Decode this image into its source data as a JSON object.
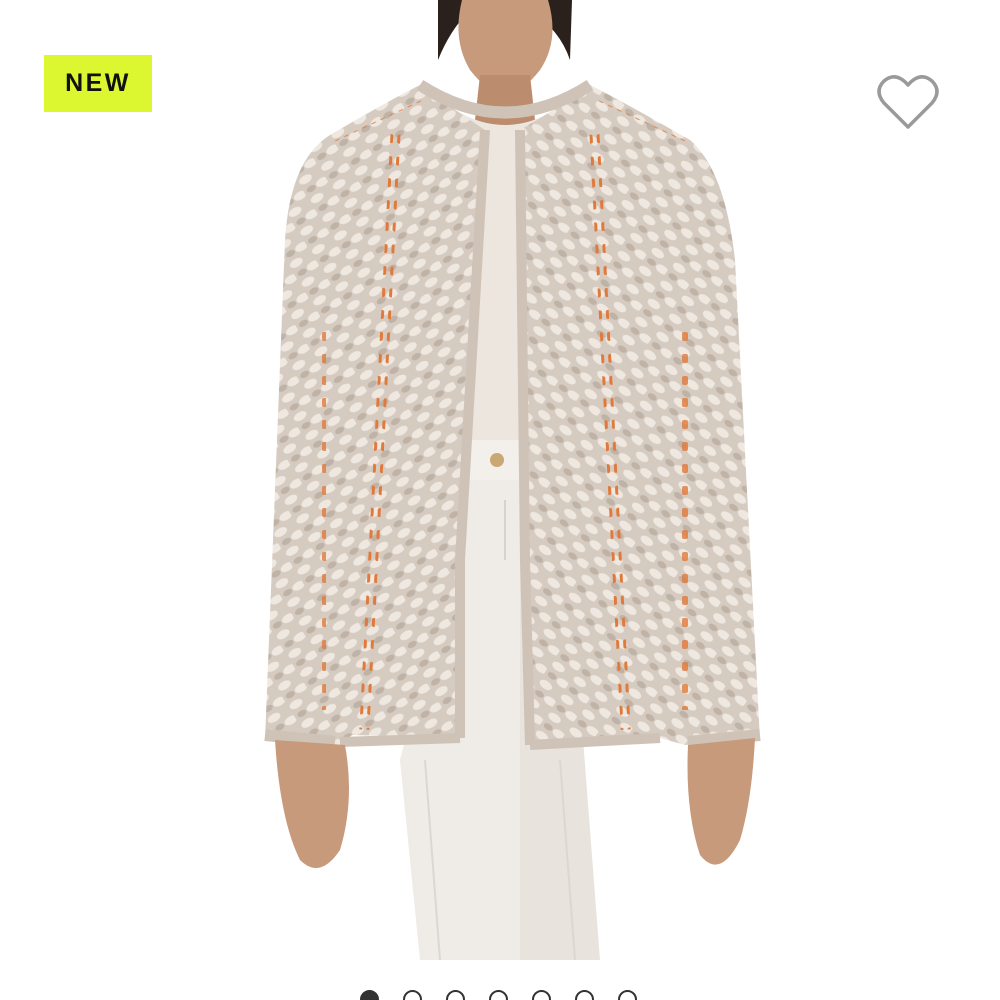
{
  "product": {
    "badge_label": "NEW",
    "image_icon": "product-photo-cardigan",
    "wishlist_icon": "heart-outline-icon",
    "carousel": {
      "count": 7,
      "active_index": 0
    }
  },
  "colors": {
    "badge_bg": "#dcf62f",
    "badge_text": "#111111",
    "heart_stroke": "#9a9a9a",
    "jacket_base": "#d9cfc6",
    "jacket_weave": "#c7bbb0",
    "accent_orange": "#e07a3c",
    "pants": "#efebe6",
    "skin": "#c89a7c",
    "hair": "#2a201c"
  }
}
